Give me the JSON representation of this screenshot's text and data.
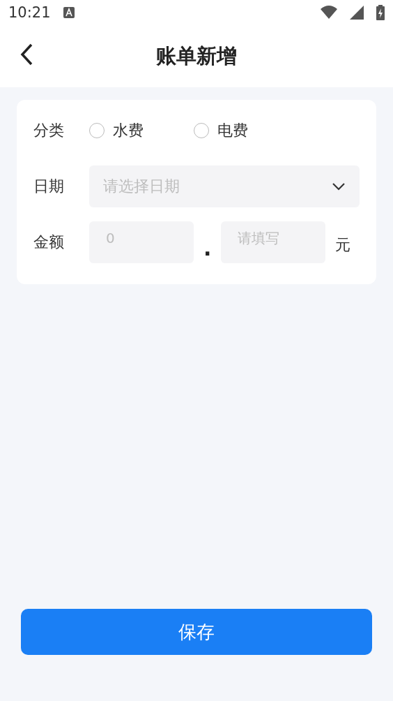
{
  "status_bar": {
    "time": "10:21"
  },
  "header": {
    "title": "账单新增"
  },
  "form": {
    "category": {
      "label": "分类",
      "options": [
        {
          "label": "水费",
          "selected": false
        },
        {
          "label": "电费",
          "selected": false
        }
      ]
    },
    "date": {
      "label": "日期",
      "placeholder": "请选择日期"
    },
    "amount": {
      "label": "金额",
      "integer_placeholder": "0",
      "separator": ".",
      "decimal_placeholder": "请填写",
      "unit": "元"
    }
  },
  "save_button": {
    "label": "保存"
  }
}
